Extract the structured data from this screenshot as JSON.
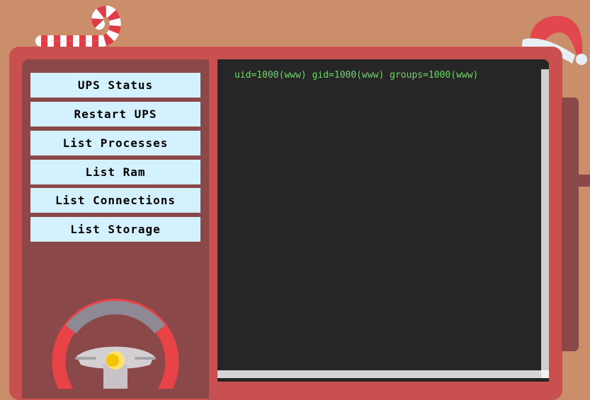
{
  "menu": {
    "items": [
      {
        "label": "UPS Status"
      },
      {
        "label": "Restart UPS"
      },
      {
        "label": "List Processes"
      },
      {
        "label": "List Ram"
      },
      {
        "label": "List Connections"
      },
      {
        "label": "List Storage"
      }
    ]
  },
  "terminal": {
    "output": "uid=1000(www) gid=1000(www) groups=1000(www)"
  },
  "decor": {
    "top_left": "candy-cane-icon",
    "top_right": "santa-hat-icon",
    "panel_bottom": "steering-wheel-icon"
  },
  "colors": {
    "background": "#cb8e6b",
    "cabinet": "#c85050",
    "panel": "#8b4848",
    "button": "#d3f1ff",
    "terminal_bg": "#262626",
    "terminal_text": "#6cd66c"
  }
}
